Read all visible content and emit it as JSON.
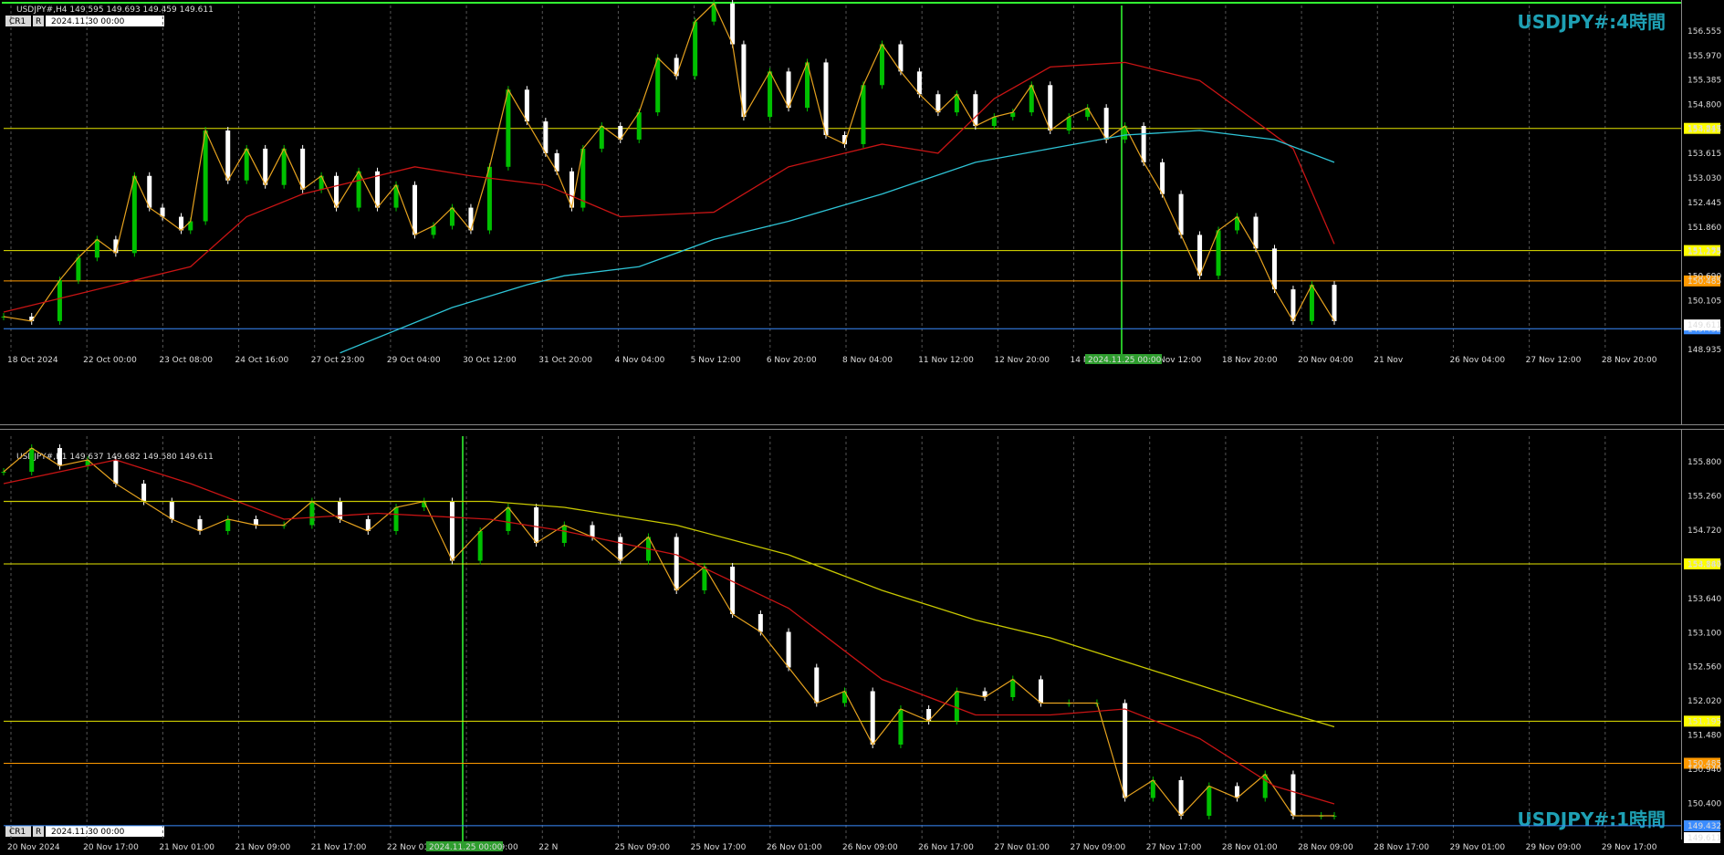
{
  "colors": {
    "background": "#000000",
    "bull": "#00c000",
    "bear": "#ffffff",
    "ma_red": "#c81414",
    "ma_cyan": "#2ec4d6",
    "ma_yellow": "#c8c800",
    "zigzag": "#e6a21e",
    "line_yellow": "#e6e600",
    "line_orange": "#ff9900",
    "line_blue": "#3b8cff",
    "line_green": "#1f9a1f",
    "vline": "#33ff33",
    "title": "#1ea0b4"
  },
  "chart_data": [
    {
      "type": "line",
      "panel": "upper",
      "header": "USDJPY#,H4  149.595 149.693 149.459 149.611",
      "title": "USDJPY#:4時間",
      "buttons": {
        "cr": "CR1",
        "r": "R"
      },
      "date_input": "2024.11.30 00:00",
      "y_ticks": [
        "156.555",
        "155.970",
        "155.385",
        "154.800",
        "154.215",
        "153.615",
        "153.030",
        "152.445",
        "151.860",
        "151.275",
        "150.690",
        "150.105",
        "149.611",
        "148.935"
      ],
      "ylim": [
        148.935,
        156.555
      ],
      "x_ticks": [
        "18 Oct 2024",
        "22 Oct 00:00",
        "23 Oct 08:00",
        "24 Oct 16:00",
        "27 Oct 23:00",
        "29 Oct 04:00",
        "30 Oct 12:00",
        "31 Oct 20:00",
        "4 Nov 04:00",
        "5 Nov 12:00",
        "6 Nov 20:00",
        "8 Nov 04:00",
        "11 Nov 12:00",
        "12 Nov 20:00",
        "14 Nov 04:00",
        "15 Nov 12:00",
        "18 Nov 20:00",
        "20 Nov 04:00",
        "21 Nov",
        "26 Nov 04:00",
        "27 Nov 12:00",
        "28 Nov 20:00"
      ],
      "cursor_label": "2024.11.25 00:00",
      "levels": [
        {
          "label": "153.847",
          "value": 153.847,
          "color": "line_yellow",
          "tag": "#ffff00"
        },
        {
          "label": "151.155",
          "value": 151.155,
          "color": "line_yellow",
          "tag": "#ffff00"
        },
        {
          "label": "150.485",
          "value": 150.485,
          "color": "line_orange",
          "tag": "#ff9900"
        },
        {
          "label": "149.432",
          "value": 149.432,
          "color": "line_blue",
          "tag": "#3b8cff"
        }
      ],
      "price_tag": "149.611",
      "series": [
        {
          "name": "price",
          "x": [
            0,
            15,
            30,
            40,
            50,
            60,
            70,
            78,
            85,
            95,
            100,
            108,
            120,
            130,
            140,
            150,
            160,
            170,
            178,
            190,
            200,
            210,
            220,
            230,
            240,
            250,
            260,
            270,
            280,
            290,
            296,
            304,
            310,
            320,
            330,
            340,
            350,
            360,
            370,
            380,
            390,
            396,
            410,
            420,
            430,
            440,
            450,
            460,
            470,
            480,
            490,
            500,
            510,
            520,
            530,
            540,
            550,
            560,
            570,
            580,
            590,
            600,
            610,
            620,
            630,
            640,
            650,
            660,
            670,
            680,
            690,
            700,
            712
          ],
          "values": [
            149.7,
            149.6,
            150.5,
            151.0,
            151.4,
            151.1,
            152.8,
            152.1,
            151.9,
            151.6,
            151.8,
            153.8,
            152.7,
            153.4,
            152.6,
            153.4,
            152.5,
            152.8,
            152.1,
            152.9,
            152.1,
            152.6,
            151.5,
            151.7,
            152.1,
            151.6,
            153.0,
            154.7,
            154.0,
            153.3,
            152.9,
            152.1,
            153.4,
            153.9,
            153.6,
            154.2,
            155.4,
            155.0,
            156.2,
            156.6,
            155.7,
            154.1,
            155.1,
            154.3,
            155.3,
            153.7,
            153.5,
            154.8,
            155.7,
            155.1,
            154.6,
            154.2,
            154.6,
            153.9,
            154.1,
            154.2,
            154.8,
            153.8,
            154.1,
            154.3,
            153.6,
            153.9,
            153.1,
            152.4,
            151.5,
            150.6,
            151.6,
            151.9,
            151.2,
            150.3,
            149.6,
            150.4,
            149.6
          ]
        },
        {
          "name": "ma_red",
          "x": [
            0,
            40,
            100,
            130,
            160,
            220,
            250,
            290,
            330,
            380,
            420,
            470,
            500,
            530,
            560,
            600,
            620,
            640,
            690,
            712
          ],
          "values": [
            149.8,
            150.2,
            150.8,
            151.9,
            152.4,
            153.0,
            152.8,
            152.6,
            151.9,
            152.0,
            153.0,
            153.5,
            153.3,
            154.5,
            155.2,
            155.3,
            155.1,
            154.9,
            153.4,
            151.3
          ]
        },
        {
          "name": "ma_cyan",
          "x": [
            180,
            240,
            280,
            300,
            340,
            380,
            420,
            470,
            520,
            560,
            600,
            640,
            680,
            712
          ],
          "values": [
            148.9,
            149.9,
            150.4,
            150.6,
            150.8,
            151.4,
            151.8,
            152.4,
            153.1,
            153.4,
            153.7,
            153.8,
            153.6,
            153.1
          ]
        }
      ]
    },
    {
      "type": "line",
      "panel": "lower",
      "header": "USDJPY#,H1  149.637 149.682 149.580 149.611",
      "title": "USDJPY#:1時間",
      "buttons": {
        "cr": "CR1",
        "r": "R"
      },
      "date_input": "2024.11.30 00:00",
      "y_ticks": [
        "155.800",
        "155.260",
        "154.720",
        "154.180",
        "153.640",
        "153.100",
        "152.560",
        "152.020",
        "151.480",
        "150.940",
        "150.400",
        "149.611"
      ],
      "ylim": [
        149.2,
        156.0
      ],
      "x_ticks": [
        "20 Nov 2024",
        "20 Nov 17:00",
        "21 Nov 01:00",
        "21 Nov 09:00",
        "21 Nov 17:00",
        "22 Nov 01:00",
        "22 Nov 09:00",
        "22 N",
        "25 Nov 09:00",
        "25 Nov 17:00",
        "26 Nov 01:00",
        "26 Nov 09:00",
        "26 Nov 17:00",
        "27 Nov 01:00",
        "27 Nov 09:00",
        "27 Nov 17:00",
        "28 Nov 01:00",
        "28 Nov 09:00",
        "28 Nov 17:00",
        "29 Nov 01:00",
        "29 Nov 09:00",
        "29 Nov 17:00"
      ],
      "cursor_label": "2024.11.25 00:00",
      "levels": [
        {
          "label": "153.847",
          "value": 153.847,
          "color": "line_yellow",
          "tag": "#ffff00"
        },
        {
          "label": "151.195",
          "value": 151.195,
          "color": "line_yellow",
          "tag": "#ffff00"
        },
        {
          "label": "150.485",
          "value": 150.485,
          "color": "line_orange",
          "tag": "#ff9900"
        },
        {
          "label": "149.432",
          "value": 149.432,
          "color": "line_blue",
          "tag": "#3b8cff"
        }
      ],
      "price_tag": "149.611",
      "series": [
        {
          "name": "price",
          "x": [
            0,
            15,
            30,
            45,
            60,
            75,
            90,
            105,
            120,
            135,
            150,
            165,
            180,
            195,
            210,
            225,
            240,
            255,
            270,
            285,
            300,
            315,
            330,
            345,
            360,
            375,
            390,
            405,
            420,
            435,
            450,
            465,
            480,
            495,
            510,
            525,
            540,
            555,
            570,
            585,
            600,
            615,
            630,
            645,
            660,
            675,
            690,
            705,
            712
          ],
          "values": [
            155.4,
            155.8,
            155.5,
            155.6,
            155.2,
            154.9,
            154.6,
            154.4,
            154.6,
            154.5,
            154.5,
            154.9,
            154.6,
            154.4,
            154.8,
            154.9,
            153.9,
            154.4,
            154.8,
            154.2,
            154.5,
            154.3,
            153.9,
            154.3,
            153.4,
            153.8,
            153.0,
            152.7,
            152.1,
            151.5,
            151.7,
            150.8,
            151.4,
            151.2,
            151.7,
            151.6,
            151.9,
            151.5,
            151.5,
            151.5,
            149.9,
            150.2,
            149.6,
            150.1,
            149.9,
            150.3,
            149.6,
            149.6,
            149.6
          ]
        },
        {
          "name": "ma_red",
          "x": [
            0,
            60,
            100,
            150,
            200,
            260,
            300,
            360,
            420,
            470,
            520,
            560,
            600,
            640,
            680,
            712
          ],
          "values": [
            155.2,
            155.6,
            155.2,
            154.6,
            154.7,
            154.6,
            154.4,
            154.0,
            153.1,
            151.9,
            151.3,
            151.3,
            151.4,
            150.9,
            150.1,
            149.8
          ]
        },
        {
          "name": "ma_yellow",
          "x": [
            0,
            100,
            200,
            260,
            300,
            360,
            420,
            470,
            520,
            560,
            600,
            640,
            680,
            712
          ],
          "values": [
            154.9,
            154.9,
            154.9,
            154.9,
            154.8,
            154.5,
            154.0,
            153.4,
            152.9,
            152.6,
            152.2,
            151.8,
            151.4,
            151.1
          ]
        }
      ]
    }
  ]
}
